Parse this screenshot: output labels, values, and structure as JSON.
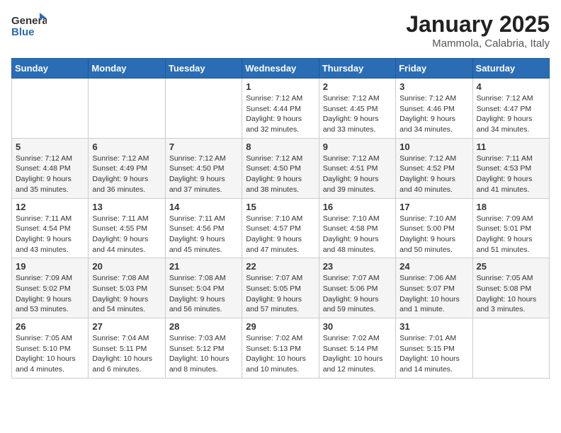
{
  "logo": {
    "line1": "General",
    "line2": "Blue"
  },
  "title": "January 2025",
  "location": "Mammola, Calabria, Italy",
  "days_of_week": [
    "Sunday",
    "Monday",
    "Tuesday",
    "Wednesday",
    "Thursday",
    "Friday",
    "Saturday"
  ],
  "weeks": [
    [
      {
        "day": "",
        "info": ""
      },
      {
        "day": "",
        "info": ""
      },
      {
        "day": "",
        "info": ""
      },
      {
        "day": "1",
        "info": "Sunrise: 7:12 AM\nSunset: 4:44 PM\nDaylight: 9 hours and 32 minutes."
      },
      {
        "day": "2",
        "info": "Sunrise: 7:12 AM\nSunset: 4:45 PM\nDaylight: 9 hours and 33 minutes."
      },
      {
        "day": "3",
        "info": "Sunrise: 7:12 AM\nSunset: 4:46 PM\nDaylight: 9 hours and 34 minutes."
      },
      {
        "day": "4",
        "info": "Sunrise: 7:12 AM\nSunset: 4:47 PM\nDaylight: 9 hours and 34 minutes."
      }
    ],
    [
      {
        "day": "5",
        "info": "Sunrise: 7:12 AM\nSunset: 4:48 PM\nDaylight: 9 hours and 35 minutes."
      },
      {
        "day": "6",
        "info": "Sunrise: 7:12 AM\nSunset: 4:49 PM\nDaylight: 9 hours and 36 minutes."
      },
      {
        "day": "7",
        "info": "Sunrise: 7:12 AM\nSunset: 4:50 PM\nDaylight: 9 hours and 37 minutes."
      },
      {
        "day": "8",
        "info": "Sunrise: 7:12 AM\nSunset: 4:50 PM\nDaylight: 9 hours and 38 minutes."
      },
      {
        "day": "9",
        "info": "Sunrise: 7:12 AM\nSunset: 4:51 PM\nDaylight: 9 hours and 39 minutes."
      },
      {
        "day": "10",
        "info": "Sunrise: 7:12 AM\nSunset: 4:52 PM\nDaylight: 9 hours and 40 minutes."
      },
      {
        "day": "11",
        "info": "Sunrise: 7:11 AM\nSunset: 4:53 PM\nDaylight: 9 hours and 41 minutes."
      }
    ],
    [
      {
        "day": "12",
        "info": "Sunrise: 7:11 AM\nSunset: 4:54 PM\nDaylight: 9 hours and 43 minutes."
      },
      {
        "day": "13",
        "info": "Sunrise: 7:11 AM\nSunset: 4:55 PM\nDaylight: 9 hours and 44 minutes."
      },
      {
        "day": "14",
        "info": "Sunrise: 7:11 AM\nSunset: 4:56 PM\nDaylight: 9 hours and 45 minutes."
      },
      {
        "day": "15",
        "info": "Sunrise: 7:10 AM\nSunset: 4:57 PM\nDaylight: 9 hours and 47 minutes."
      },
      {
        "day": "16",
        "info": "Sunrise: 7:10 AM\nSunset: 4:58 PM\nDaylight: 9 hours and 48 minutes."
      },
      {
        "day": "17",
        "info": "Sunrise: 7:10 AM\nSunset: 5:00 PM\nDaylight: 9 hours and 50 minutes."
      },
      {
        "day": "18",
        "info": "Sunrise: 7:09 AM\nSunset: 5:01 PM\nDaylight: 9 hours and 51 minutes."
      }
    ],
    [
      {
        "day": "19",
        "info": "Sunrise: 7:09 AM\nSunset: 5:02 PM\nDaylight: 9 hours and 53 minutes."
      },
      {
        "day": "20",
        "info": "Sunrise: 7:08 AM\nSunset: 5:03 PM\nDaylight: 9 hours and 54 minutes."
      },
      {
        "day": "21",
        "info": "Sunrise: 7:08 AM\nSunset: 5:04 PM\nDaylight: 9 hours and 56 minutes."
      },
      {
        "day": "22",
        "info": "Sunrise: 7:07 AM\nSunset: 5:05 PM\nDaylight: 9 hours and 57 minutes."
      },
      {
        "day": "23",
        "info": "Sunrise: 7:07 AM\nSunset: 5:06 PM\nDaylight: 9 hours and 59 minutes."
      },
      {
        "day": "24",
        "info": "Sunrise: 7:06 AM\nSunset: 5:07 PM\nDaylight: 10 hours and 1 minute."
      },
      {
        "day": "25",
        "info": "Sunrise: 7:05 AM\nSunset: 5:08 PM\nDaylight: 10 hours and 3 minutes."
      }
    ],
    [
      {
        "day": "26",
        "info": "Sunrise: 7:05 AM\nSunset: 5:10 PM\nDaylight: 10 hours and 4 minutes."
      },
      {
        "day": "27",
        "info": "Sunrise: 7:04 AM\nSunset: 5:11 PM\nDaylight: 10 hours and 6 minutes."
      },
      {
        "day": "28",
        "info": "Sunrise: 7:03 AM\nSunset: 5:12 PM\nDaylight: 10 hours and 8 minutes."
      },
      {
        "day": "29",
        "info": "Sunrise: 7:02 AM\nSunset: 5:13 PM\nDaylight: 10 hours and 10 minutes."
      },
      {
        "day": "30",
        "info": "Sunrise: 7:02 AM\nSunset: 5:14 PM\nDaylight: 10 hours and 12 minutes."
      },
      {
        "day": "31",
        "info": "Sunrise: 7:01 AM\nSunset: 5:15 PM\nDaylight: 10 hours and 14 minutes."
      },
      {
        "day": "",
        "info": ""
      }
    ]
  ]
}
